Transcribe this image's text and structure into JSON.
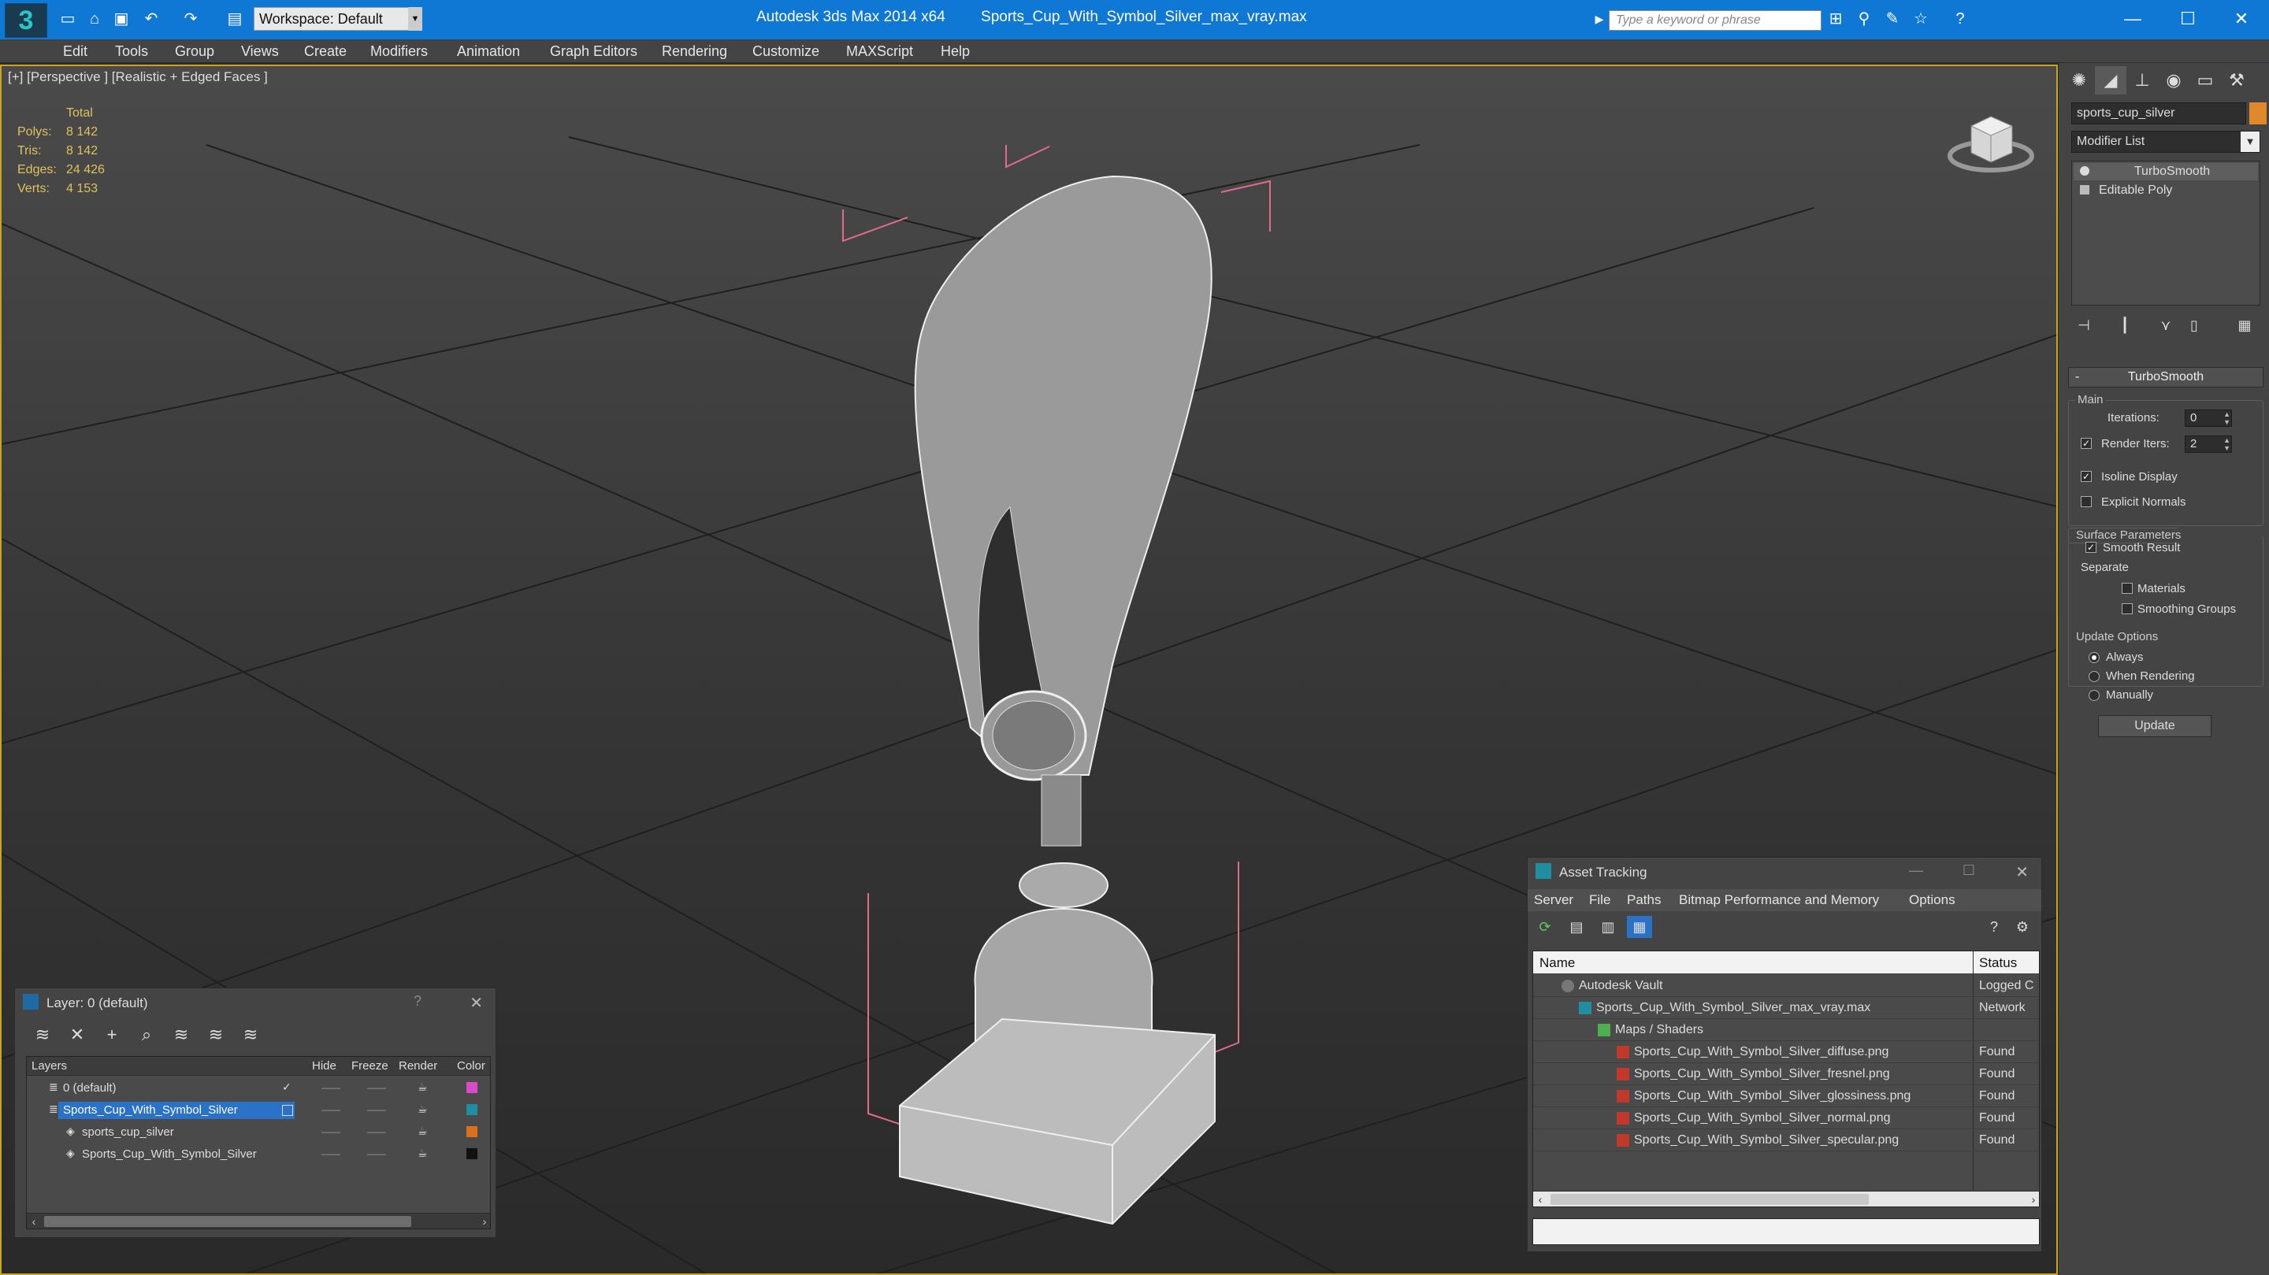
{
  "app": {
    "title_app": "Autodesk 3ds Max  2014 x64",
    "title_file": "Sports_Cup_With_Symbol_Silver_max_vray.max",
    "workspace": "Workspace: Default",
    "search_placeholder": "Type a keyword or phrase",
    "accent_color": "#0f78d4"
  },
  "menu": [
    "Edit",
    "Tools",
    "Group",
    "Views",
    "Create",
    "Modifiers",
    "Animation",
    "Graph Editors",
    "Rendering",
    "Customize",
    "MAXScript",
    "Help"
  ],
  "viewport": {
    "label": "[+] [Perspective ] [Realistic + Edged Faces ]",
    "stats_header": "Total",
    "stats": [
      {
        "key": "Polys:",
        "value": "8 142"
      },
      {
        "key": "Tris:",
        "value": "8 142"
      },
      {
        "key": "Edges:",
        "value": "24 426"
      },
      {
        "key": "Verts:",
        "value": "4 153"
      }
    ],
    "stats_color": "#e0c25a"
  },
  "command_panel": {
    "object_name": "sports_cup_silver",
    "object_color": "#e0882a",
    "modifier_list": "Modifier List",
    "stack": [
      "TurboSmooth",
      "Editable Poly"
    ],
    "rollout_title": "TurboSmooth",
    "main_group": "Main",
    "iterations_label": "Iterations:",
    "iterations_value": "0",
    "render_iters_label": "Render Iters:",
    "render_iters_value": "2",
    "isoline_label": "Isoline Display",
    "explicit_normals_label": "Explicit Normals",
    "surface_group": "Surface Parameters",
    "smooth_result_label": "Smooth Result",
    "separate_label": "Separate",
    "materials_label": "Materials",
    "smoothing_groups_label": "Smoothing Groups",
    "update_group": "Update Options",
    "always_label": "Always",
    "when_rendering_label": "When Rendering",
    "manually_label": "Manually",
    "update_button": "Update"
  },
  "layer_dialog": {
    "title": "Layer: 0 (default)",
    "question": "?",
    "columns": [
      "Layers",
      "Hide",
      "Freeze",
      "Render",
      "Color"
    ],
    "rows": [
      {
        "name": "0 (default)",
        "color": "#d94bc8"
      },
      {
        "name": "Sports_Cup_With_Symbol_Silver",
        "color": "#1f8ea0"
      },
      {
        "name": "sports_cup_silver",
        "color": "#d8701e"
      },
      {
        "name": "Sports_Cup_With_Symbol_Silver",
        "color": "#111111"
      }
    ]
  },
  "asset_dialog": {
    "title": "Asset Tracking",
    "menu": [
      "Server",
      "File",
      "Paths",
      "Bitmap Performance and Memory",
      "Options"
    ],
    "columns": [
      "Name",
      "Status"
    ],
    "rows": [
      {
        "name": "Autodesk Vault",
        "status": "Logged C"
      },
      {
        "name": "Sports_Cup_With_Symbol_Silver_max_vray.max",
        "status": "Network"
      },
      {
        "name": "Maps / Shaders",
        "status": ""
      },
      {
        "name": "Sports_Cup_With_Symbol_Silver_diffuse.png",
        "status": "Found"
      },
      {
        "name": "Sports_Cup_With_Symbol_Silver_fresnel.png",
        "status": "Found"
      },
      {
        "name": "Sports_Cup_With_Symbol_Silver_glossiness.png",
        "status": "Found"
      },
      {
        "name": "Sports_Cup_With_Symbol_Silver_normal.png",
        "status": "Found"
      },
      {
        "name": "Sports_Cup_With_Symbol_Silver_specular.png",
        "status": "Found"
      }
    ]
  }
}
